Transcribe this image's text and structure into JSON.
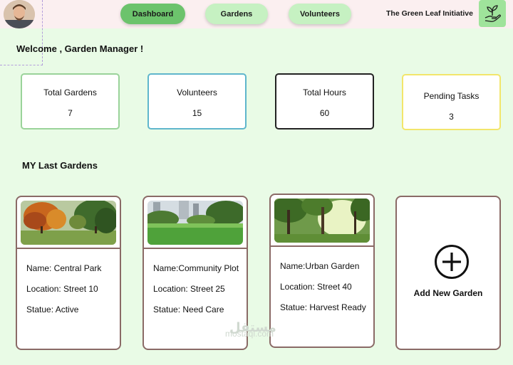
{
  "header": {
    "nav": {
      "dashboard": "Dashboard",
      "gardens": "Gardens",
      "volunteers": "Volunteers"
    },
    "org_name": "The Green Leaf Initiative",
    "logo_icon": "hand-plant-icon",
    "avatar_icon": "user-avatar"
  },
  "welcome": "Welcome , Garden Manager !",
  "stats": [
    {
      "label": "Total Gardens",
      "value": "7",
      "border": "#9ad39a"
    },
    {
      "label": "Volunteers",
      "value": "15",
      "border": "#5fb6cc"
    },
    {
      "label": "Total Hours",
      "value": "60",
      "border": "#222222"
    },
    {
      "label": "Pending Tasks",
      "value": "3",
      "border": "#f2e66b"
    }
  ],
  "section_title": "MY Last Gardens",
  "gardens": [
    {
      "name": "Name: Central Park",
      "location": "Location: Street 10",
      "status": "Statue: Active"
    },
    {
      "name": "Name:Community Plot",
      "location": "Location: Street 25",
      "status": "Statue: Need Care"
    },
    {
      "name": "Name:Urban Garden",
      "location": "Location: Street 40",
      "status": "Statue: Harvest Ready"
    }
  ],
  "add_garden": {
    "label": "Add New Garden",
    "icon": "plus-circle-icon"
  },
  "watermark": {
    "latin": "mostaql.com",
    "arabic": "مستقل"
  },
  "colors": {
    "background": "#e9fbe6",
    "topbar": "#fbeff0",
    "nav_active": "#6cc36c",
    "nav_inactive": "#c6f1c2",
    "card_border": "#8a6a66"
  }
}
